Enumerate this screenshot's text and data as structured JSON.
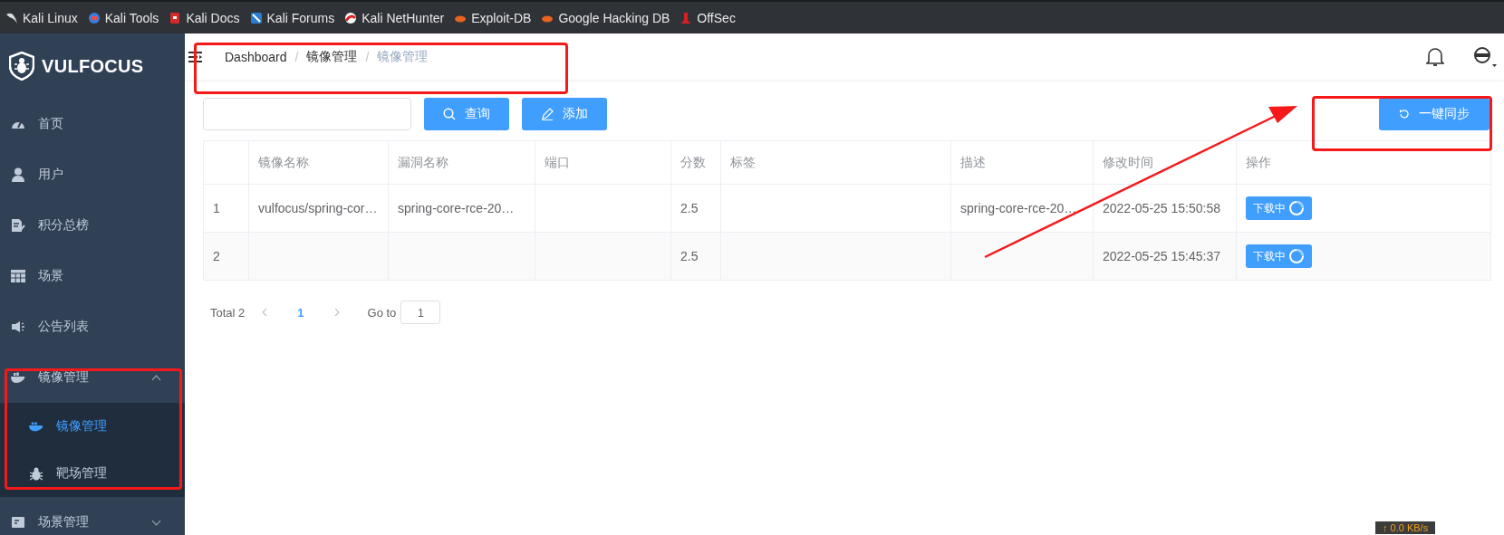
{
  "browser_bookmarks": [
    {
      "label": "Kali Linux"
    },
    {
      "label": "Kali Tools"
    },
    {
      "label": "Kali Docs"
    },
    {
      "label": "Kali Forums"
    },
    {
      "label": "Kali NetHunter"
    },
    {
      "label": "Exploit-DB"
    },
    {
      "label": "Google Hacking DB"
    },
    {
      "label": "OffSec"
    }
  ],
  "sidebar": {
    "logo": "VULFOCUS",
    "items": [
      {
        "label": "首页",
        "selected": false
      },
      {
        "label": "用户",
        "selected": false
      },
      {
        "label": "积分总榜",
        "selected": false
      },
      {
        "label": "场景",
        "selected": false
      },
      {
        "label": "公告列表",
        "selected": false
      },
      {
        "label": "镜像管理",
        "expanded": true,
        "children": [
          {
            "label": "镜像管理",
            "selected": true
          },
          {
            "label": "靶场管理",
            "selected": false
          }
        ]
      },
      {
        "label": "场景管理",
        "expanded": false
      }
    ]
  },
  "breadcrumb": [
    {
      "label": "Dashboard",
      "current": false
    },
    {
      "separator": "/",
      "label": "镜像管理",
      "current": false
    },
    {
      "separator": "/",
      "label": "镜像管理",
      "current": true
    }
  ],
  "toolbar": {
    "buttons": [
      {
        "label": "查询",
        "kind": "search"
      },
      {
        "label": "添加",
        "kind": "add"
      }
    ],
    "sync_button": {
      "label": "一键同步"
    }
  },
  "table": {
    "columns": [
      {
        "label": "镜像名称"
      },
      {
        "label": "漏洞名称"
      },
      {
        "label": "端口"
      },
      {
        "label": "分数"
      },
      {
        "label": "标签"
      },
      {
        "label": "描述"
      },
      {
        "label": "修改时间"
      },
      {
        "label": "操作"
      }
    ],
    "rows": [
      {
        "index": "1",
        "cells": [
          "vulfocus/spring-cor…",
          "spring-core-rce-20…",
          null,
          "2.5",
          null,
          "spring-core-rce-20…",
          "2022-05-25 15:50:58"
        ],
        "action": "下载中"
      },
      {
        "index": "2",
        "cells": [
          null,
          null,
          null,
          "2.5",
          null,
          null,
          "2022-05-25 15:45:37"
        ],
        "action": "下载中"
      }
    ]
  },
  "pagination": {
    "total": "Total 2",
    "pages": [
      {
        "label": "1",
        "selected": true
      }
    ],
    "goto_label": "Go to",
    "goto_value": "1"
  },
  "net_speed": "↑ 0.0 KB/s",
  "annotations": [
    {
      "kind": "box"
    },
    {
      "kind": "box"
    },
    {
      "kind": "box"
    },
    {
      "kind": "arrow"
    }
  ]
}
